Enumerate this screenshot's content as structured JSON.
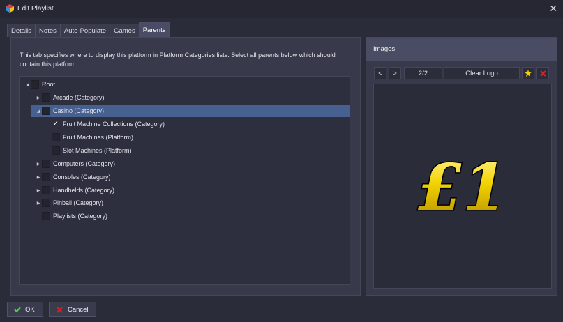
{
  "window": {
    "title": "Edit Playlist",
    "close_glyph": "✕"
  },
  "tabs": [
    {
      "label": "Details"
    },
    {
      "label": "Notes"
    },
    {
      "label": "Auto-Populate"
    },
    {
      "label": "Games"
    },
    {
      "label": "Parents",
      "active": true
    }
  ],
  "parents": {
    "description": "This tab specifies where to display this platform in Platform Categories lists. Select all parents below which should contain this platform.",
    "tree": [
      {
        "label": "Root",
        "expanded": true,
        "checked": false
      },
      {
        "label": "Arcade (Category)",
        "expanded": false,
        "checked": false
      },
      {
        "label": "Casino (Category)",
        "expanded": true,
        "checked": false,
        "selected": true
      },
      {
        "label": "Fruit Machine Collections (Category)",
        "checked": true
      },
      {
        "label": "Fruit Machines (Platform)",
        "checked": false
      },
      {
        "label": "Slot Machines (Platform)",
        "checked": false
      },
      {
        "label": "Computers (Category)",
        "expanded": false,
        "checked": false
      },
      {
        "label": "Consoles (Category)",
        "expanded": false,
        "checked": false
      },
      {
        "label": "Handhelds (Category)",
        "expanded": false,
        "checked": false
      },
      {
        "label": "Pinball (Category)",
        "expanded": false,
        "checked": false
      },
      {
        "label": "Playlists (Category)",
        "checked": false
      }
    ]
  },
  "images": {
    "header": "Images",
    "prev": "<",
    "next": ">",
    "counter": "2/2",
    "type": "Clear Logo",
    "image_text": "£1"
  },
  "footer": {
    "ok": "OK",
    "cancel": "Cancel"
  },
  "colors": {
    "background": "#2b2c3a",
    "selection": "#46608f",
    "logo_gold": "#f2d200"
  }
}
